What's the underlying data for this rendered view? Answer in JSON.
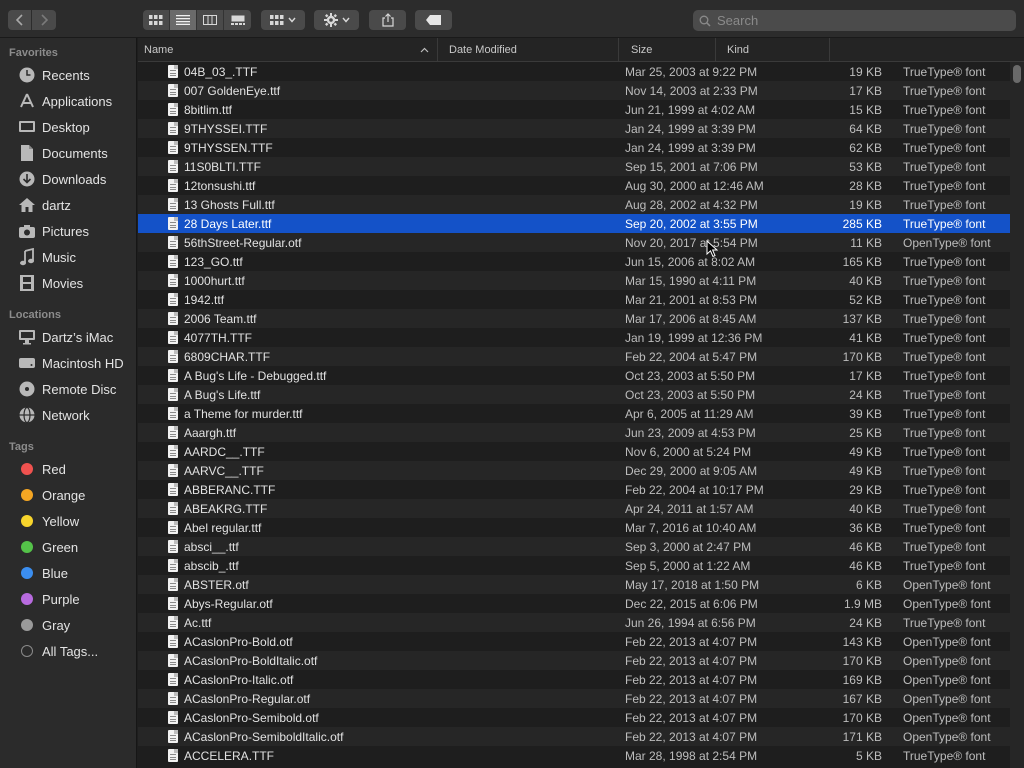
{
  "toolbar": {
    "back_icon": "chevron-left-icon",
    "forward_icon": "chevron-right-icon",
    "view_modes": [
      "icon-view",
      "list-view",
      "column-view",
      "gallery-view"
    ],
    "active_view": "list-view",
    "search_placeholder": "Search"
  },
  "sidebar": {
    "favorites_title": "Favorites",
    "favorites": [
      {
        "label": "Recents",
        "icon": "clock-icon"
      },
      {
        "label": "Applications",
        "icon": "applications-icon"
      },
      {
        "label": "Desktop",
        "icon": "desktop-icon"
      },
      {
        "label": "Documents",
        "icon": "document-icon"
      },
      {
        "label": "Downloads",
        "icon": "download-icon"
      },
      {
        "label": "dartz",
        "icon": "home-icon"
      },
      {
        "label": "Pictures",
        "icon": "camera-icon"
      },
      {
        "label": "Music",
        "icon": "music-note-icon"
      },
      {
        "label": "Movies",
        "icon": "film-icon"
      }
    ],
    "locations_title": "Locations",
    "locations": [
      {
        "label": "Dartz’s iMac",
        "icon": "imac-icon"
      },
      {
        "label": "Macintosh HD",
        "icon": "hard-drive-icon"
      },
      {
        "label": "Remote Disc",
        "icon": "disc-icon"
      },
      {
        "label": "Network",
        "icon": "globe-icon"
      }
    ],
    "tags_title": "Tags",
    "tags": [
      {
        "label": "Red",
        "color": "#f0524f"
      },
      {
        "label": "Orange",
        "color": "#f5a623"
      },
      {
        "label": "Yellow",
        "color": "#f8d52c"
      },
      {
        "label": "Green",
        "color": "#54c249"
      },
      {
        "label": "Blue",
        "color": "#3b8ef0"
      },
      {
        "label": "Purple",
        "color": "#b86bdf"
      },
      {
        "label": "Gray",
        "color": "#9a9a9a"
      },
      {
        "label": "All Tags...",
        "color": ""
      }
    ]
  },
  "columns": {
    "name": "Name",
    "date": "Date Modified",
    "size": "Size",
    "kind": "Kind"
  },
  "selected_index": 8,
  "files": [
    {
      "name": "04B_03_.TTF",
      "date": "Mar 25, 2003 at 9:22 PM",
      "size": "19 KB",
      "kind": "TrueType® font"
    },
    {
      "name": "007 GoldenEye.ttf",
      "date": "Nov 14, 2003 at 2:33 PM",
      "size": "17 KB",
      "kind": "TrueType® font"
    },
    {
      "name": "8bitlim.ttf",
      "date": "Jun 21, 1999 at 4:02 AM",
      "size": "15 KB",
      "kind": "TrueType® font"
    },
    {
      "name": "9THYSSEI.TTF",
      "date": "Jan 24, 1999 at 3:39 PM",
      "size": "64 KB",
      "kind": "TrueType® font"
    },
    {
      "name": "9THYSSEN.TTF",
      "date": "Jan 24, 1999 at 3:39 PM",
      "size": "62 KB",
      "kind": "TrueType® font"
    },
    {
      "name": "11S0BLTI.TTF",
      "date": "Sep 15, 2001 at 7:06 PM",
      "size": "53 KB",
      "kind": "TrueType® font"
    },
    {
      "name": "12tonsushi.ttf",
      "date": "Aug 30, 2000 at 12:46 AM",
      "size": "28 KB",
      "kind": "TrueType® font"
    },
    {
      "name": "13 Ghosts Full.ttf",
      "date": "Aug 28, 2002 at 4:32 PM",
      "size": "19 KB",
      "kind": "TrueType® font"
    },
    {
      "name": "28 Days Later.ttf",
      "date": "Sep 20, 2002 at 3:55 PM",
      "size": "285 KB",
      "kind": "TrueType® font"
    },
    {
      "name": "56thStreet-Regular.otf",
      "date": "Nov 20, 2017 at 5:54 PM",
      "size": "11 KB",
      "kind": "OpenType® font"
    },
    {
      "name": "123_GO.ttf",
      "date": "Jun 15, 2006 at 8:02 AM",
      "size": "165 KB",
      "kind": "TrueType® font"
    },
    {
      "name": "1000hurt.ttf",
      "date": "Mar 15, 1990 at 4:11 PM",
      "size": "40 KB",
      "kind": "TrueType® font"
    },
    {
      "name": "1942.ttf",
      "date": "Mar 21, 2001 at 8:53 PM",
      "size": "52 KB",
      "kind": "TrueType® font"
    },
    {
      "name": "2006 Team.ttf",
      "date": "Mar 17, 2006 at 8:45 AM",
      "size": "137 KB",
      "kind": "TrueType® font"
    },
    {
      "name": "4077TH.TTF",
      "date": "Jan 19, 1999 at 12:36 PM",
      "size": "41 KB",
      "kind": "TrueType® font"
    },
    {
      "name": "6809CHAR.TTF",
      "date": "Feb 22, 2004 at 5:47 PM",
      "size": "170 KB",
      "kind": "TrueType® font"
    },
    {
      "name": "A Bug's Life - Debugged.ttf",
      "date": "Oct 23, 2003 at 5:50 PM",
      "size": "17 KB",
      "kind": "TrueType® font"
    },
    {
      "name": "A Bug's Life.ttf",
      "date": "Oct 23, 2003 at 5:50 PM",
      "size": "24 KB",
      "kind": "TrueType® font"
    },
    {
      "name": "a Theme for murder.ttf",
      "date": "Apr 6, 2005 at 11:29 AM",
      "size": "39 KB",
      "kind": "TrueType® font"
    },
    {
      "name": "Aaargh.ttf",
      "date": "Jun 23, 2009 at 4:53 PM",
      "size": "25 KB",
      "kind": "TrueType® font"
    },
    {
      "name": "AARDC__.TTF",
      "date": "Nov 6, 2000 at 5:24 PM",
      "size": "49 KB",
      "kind": "TrueType® font"
    },
    {
      "name": "AARVC__.TTF",
      "date": "Dec 29, 2000 at 9:05 AM",
      "size": "49 KB",
      "kind": "TrueType® font"
    },
    {
      "name": "ABBERANC.TTF",
      "date": "Feb 22, 2004 at 10:17 PM",
      "size": "29 KB",
      "kind": "TrueType® font"
    },
    {
      "name": "ABEAKRG.TTF",
      "date": "Apr 24, 2011 at 1:57 AM",
      "size": "40 KB",
      "kind": "TrueType® font"
    },
    {
      "name": "Abel regular.ttf",
      "date": "Mar 7, 2016 at 10:40 AM",
      "size": "36 KB",
      "kind": "TrueType® font"
    },
    {
      "name": "absci__.ttf",
      "date": "Sep 3, 2000 at 2:47 PM",
      "size": "46 KB",
      "kind": "TrueType® font"
    },
    {
      "name": "abscib_.ttf",
      "date": "Sep 5, 2000 at 1:22 AM",
      "size": "46 KB",
      "kind": "TrueType® font"
    },
    {
      "name": "ABSTER.otf",
      "date": "May 17, 2018 at 1:50 PM",
      "size": "6 KB",
      "kind": "OpenType® font"
    },
    {
      "name": "Abys-Regular.otf",
      "date": "Dec 22, 2015 at 6:06 PM",
      "size": "1.9 MB",
      "kind": "OpenType® font"
    },
    {
      "name": "Ac.ttf",
      "date": "Jun 26, 1994 at 6:56 PM",
      "size": "24 KB",
      "kind": "TrueType® font"
    },
    {
      "name": "ACaslonPro-Bold.otf",
      "date": "Feb 22, 2013 at 4:07 PM",
      "size": "143 KB",
      "kind": "OpenType® font"
    },
    {
      "name": "ACaslonPro-BoldItalic.otf",
      "date": "Feb 22, 2013 at 4:07 PM",
      "size": "170 KB",
      "kind": "OpenType® font"
    },
    {
      "name": "ACaslonPro-Italic.otf",
      "date": "Feb 22, 2013 at 4:07 PM",
      "size": "169 KB",
      "kind": "OpenType® font"
    },
    {
      "name": "ACaslonPro-Regular.otf",
      "date": "Feb 22, 2013 at 4:07 PM",
      "size": "167 KB",
      "kind": "OpenType® font"
    },
    {
      "name": "ACaslonPro-Semibold.otf",
      "date": "Feb 22, 2013 at 4:07 PM",
      "size": "170 KB",
      "kind": "OpenType® font"
    },
    {
      "name": "ACaslonPro-SemiboldItalic.otf",
      "date": "Feb 22, 2013 at 4:07 PM",
      "size": "171 KB",
      "kind": "OpenType® font"
    },
    {
      "name": "ACCELERA.TTF",
      "date": "Mar 28, 1998 at 2:54 PM",
      "size": "5 KB",
      "kind": "TrueType® font"
    }
  ]
}
